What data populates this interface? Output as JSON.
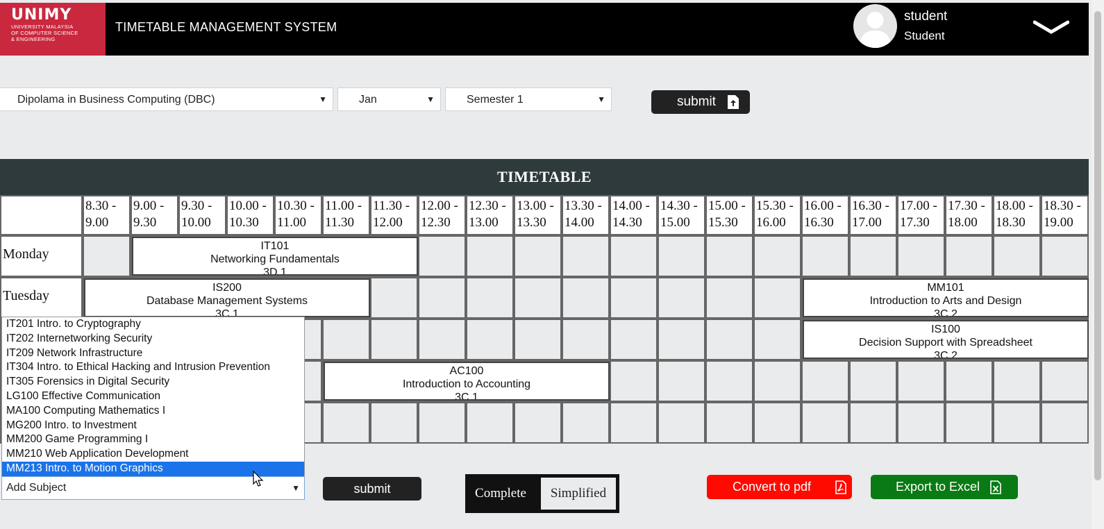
{
  "header": {
    "logo_title": "UNIMY",
    "logo_subtitle": [
      "UNIVERSITY MALAYSIA",
      "OF COMPUTER SCIENCE",
      "& ENGINEERING"
    ],
    "app_title": "TIMETABLE MANAGEMENT SYSTEM",
    "user_name": "student",
    "user_role": "Student",
    "menu_icon": "chevron-down-icon"
  },
  "filters": {
    "program": "Dipolama in Business Computing (DBC)",
    "month": "Jan",
    "semester": "Semester 1",
    "arrow": "▼",
    "submit_label": "submit",
    "submit_icon": "file-upload-icon"
  },
  "timetable": {
    "title": "TIMETABLE",
    "times": [
      "8.30 -\n9.00",
      "9.00 -\n9.30",
      "9.30 -\n10.00",
      "10.00 -\n10.30",
      "10.30 -\n11.00",
      "11.00 -\n11.30",
      "11.30 -\n12.00",
      "12.00 -\n12.30",
      "12.30 -\n13.00",
      "13.00 -\n13.30",
      "13.30 -\n14.00",
      "14.00 -\n14.30",
      "14.30 -\n15.00",
      "15.00 -\n15.30",
      "15.30 -\n16.00",
      "16.00 -\n16.30",
      "16.30 -\n17.00",
      "17.00 -\n17.30",
      "17.30 -\n18.00",
      "18.00 -\n18.30",
      "18.30 -\n19.00"
    ],
    "days": [
      "Monday",
      "Tuesday",
      "",
      "",
      ""
    ],
    "classes": [
      {
        "day": 0,
        "start": 1,
        "span": 6,
        "code": "IT101",
        "name": "Networking Fundamentals",
        "room": "3D.1"
      },
      {
        "day": 1,
        "start": 0,
        "span": 6,
        "code": "IS200",
        "name": "Database Management Systems",
        "room": "3C.1"
      },
      {
        "day": 1,
        "start": 15,
        "span": 6,
        "code": "MM101",
        "name": "Introduction to Arts and Design",
        "room": "3C.2"
      },
      {
        "day": 2,
        "start": 15,
        "span": 6,
        "code": "IS100",
        "name": "Decision Support with Spreadsheet",
        "room": "3C.2"
      },
      {
        "day": 3,
        "start": 5,
        "span": 6,
        "code": "AC100",
        "name": "Introduction to Accounting",
        "room": "3C.1"
      }
    ]
  },
  "subject_dropdown": {
    "options": [
      "IT201 Intro. to Cryptography",
      "IT202 Internetworking Security",
      "IT209 Network Infrastructure",
      "IT304 Intro. to Ethical Hacking and Intrusion Prevention",
      "IT305 Forensics in Digital Security",
      "LG100 Effective Communication",
      "MA100 Computing Mathematics I",
      "MG200 Intro. to Investment",
      "MM200 Game Programming I",
      "MM210 Web Application Development",
      "MM213 Intro. to Motion Graphics"
    ],
    "highlighted_index": 10,
    "value": "Add Subject",
    "submit_label": "submit"
  },
  "view_toggle": {
    "complete": "Complete",
    "simplified": "Simplified",
    "active": "complete"
  },
  "actions": {
    "pdf_label": "Convert to pdf",
    "pdf_icon": "pdf-file-icon",
    "excel_label": "Export to Excel",
    "excel_icon": "excel-file-icon"
  },
  "colors": {
    "brand": "#c9283e",
    "header_bg": "#000000",
    "pdf": "#ff0a00",
    "excel": "#0a7a14",
    "highlight": "#1a73e8"
  }
}
